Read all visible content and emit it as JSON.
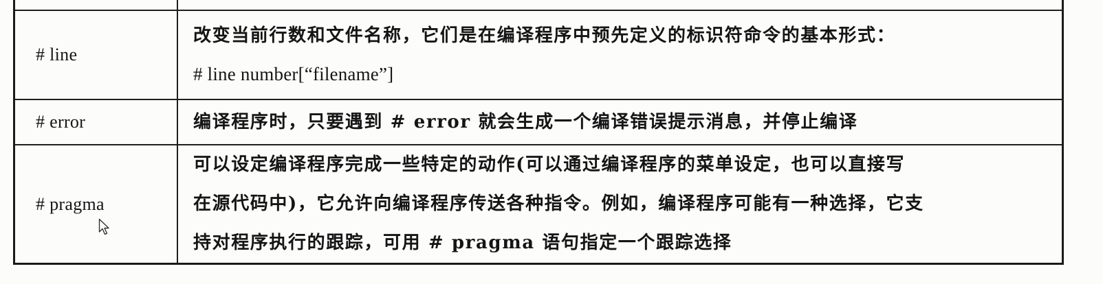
{
  "table": {
    "rows": [
      {
        "name": "# line",
        "desc_lines": [
          "改变当前行数和文件名称，它们是在编译程序中预先定义的标识符命令的基本形式：",
          "# line number[“filename”]"
        ]
      },
      {
        "name": "# error",
        "desc_lines": [
          "编译程序时，只要遇到 # error 就会生成一个编译错误提示消息，并停止编译"
        ]
      },
      {
        "name": "# pragma",
        "desc_lines": [
          "可以设定编译程序完成一些特定的动作(可以通过编译程序的菜单设定，也可以直接写",
          "在源代码中)，它允许向编译程序传送各种指令。例如，编译程序可能有一种选择，它支",
          "持对程序执行的跟踪，可用 # pragma 语句指定一个跟踪选择"
        ]
      }
    ]
  },
  "icons": {
    "cursor": "mouse-pointer-icon"
  },
  "colors": {
    "border": "#1e1e1e",
    "text": "#151515",
    "background": "#fcfcfb"
  }
}
